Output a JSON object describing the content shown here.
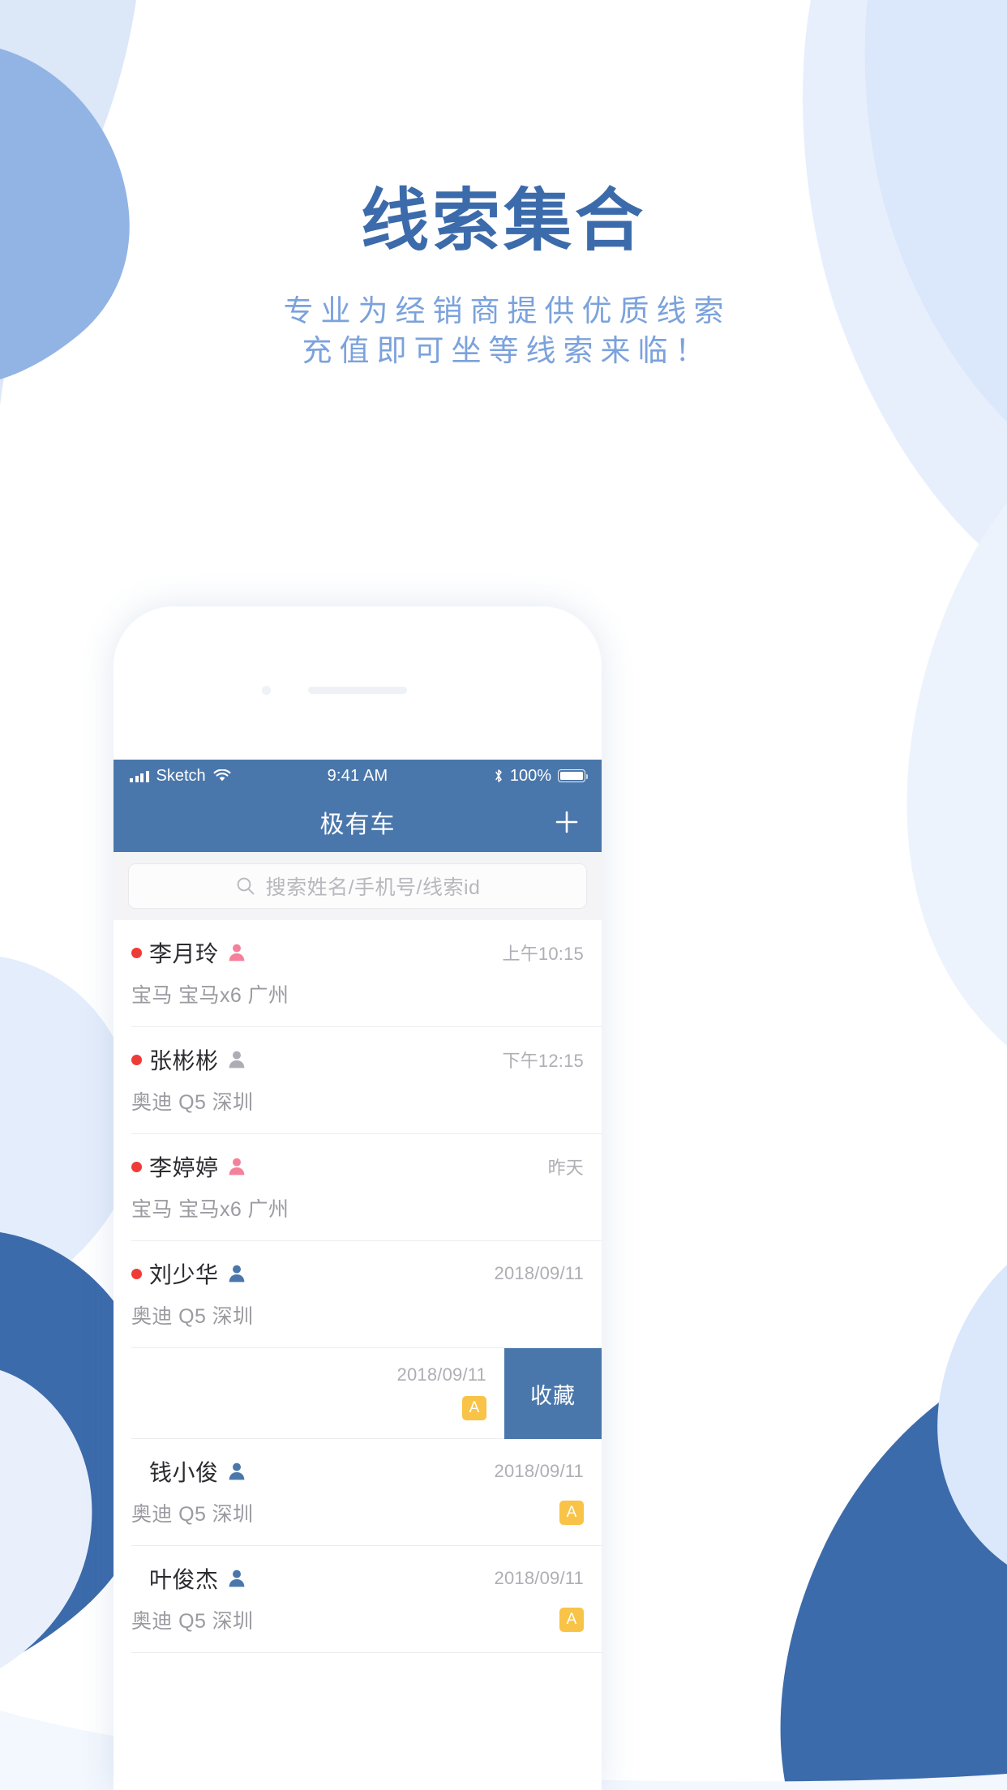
{
  "hero": {
    "title": "线索集合",
    "subtitle_line1": "专业为经销商提供优质线索",
    "subtitle_line2": "充值即可坐等线索来临！",
    "title_color": "#3c6bab",
    "subtitle_color": "#7ba2dc"
  },
  "statusbar": {
    "carrier": "Sketch",
    "time": "9:41 AM",
    "battery_percent": "100%",
    "signal_icon": "signal-bars-icon",
    "wifi_icon": "wifi-icon",
    "bluetooth_icon": "bluetooth-icon",
    "battery_icon": "battery-full-icon"
  },
  "navbar": {
    "title": "极有车",
    "add_icon": "plus-icon",
    "background": "#4a77ab"
  },
  "search": {
    "placeholder": "搜索姓名/手机号/线索id",
    "icon": "search-icon"
  },
  "list": {
    "rows": [
      {
        "unread": true,
        "name": "李月玲",
        "gender": "female",
        "time": "上午10:15",
        "desc": "宝马 宝马x6 广州",
        "badge": "",
        "swiped": false
      },
      {
        "unread": true,
        "name": "张彬彬",
        "gender": "unknown",
        "time": "下午12:15",
        "desc": "奥迪 Q5 深圳",
        "badge": "",
        "swiped": false
      },
      {
        "unread": true,
        "name": "李婷婷",
        "gender": "female",
        "time": "昨天",
        "desc": "宝马 宝马x6 广州",
        "badge": "",
        "swiped": false
      },
      {
        "unread": true,
        "name": "刘少华",
        "gender": "male",
        "time": "2018/09/11",
        "desc": "奥迪 Q5 深圳",
        "badge": "",
        "swiped": false
      },
      {
        "unread": false,
        "name": "",
        "gender": "none",
        "time": "2018/09/11",
        "desc": "",
        "badge": "A",
        "swiped": true,
        "swipe_action_label": "收藏"
      },
      {
        "unread": false,
        "name": "钱小俊",
        "gender": "male",
        "time": "2018/09/11",
        "desc": "奥迪 Q5 深圳",
        "badge": "A",
        "swiped": false
      },
      {
        "unread": false,
        "name": "叶俊杰",
        "gender": "male",
        "time": "2018/09/11",
        "desc": "奥迪 Q5 深圳",
        "badge": "A",
        "swiped": false
      }
    ]
  },
  "colors": {
    "brand_blue": "#4a77ab",
    "unread_dot": "#ef3b37",
    "badge_yellow": "#f8c347",
    "female_pink": "#f4809b",
    "male_blue": "#4a77ab",
    "unknown_gray": "#adadb5"
  }
}
